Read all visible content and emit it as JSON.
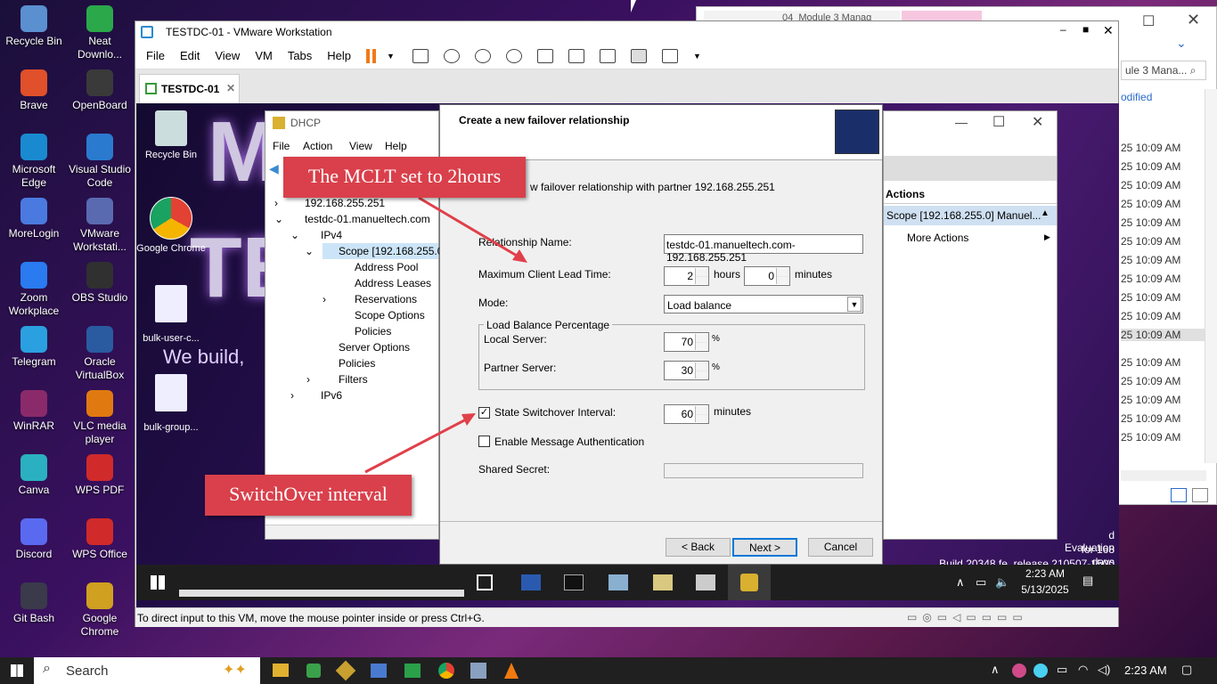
{
  "desktop": {
    "icons": [
      {
        "label": "Recycle Bin",
        "color": "#5a8fd0"
      },
      {
        "label": "Neat Downlo...",
        "color": "#2aa84a"
      },
      {
        "label": "Brave",
        "color": "#e0502a"
      },
      {
        "label": "OpenBoard",
        "color": "#3a3a3a"
      },
      {
        "label": "Microsoft Edge",
        "color": "#1a8ad0"
      },
      {
        "label": "Visual Studio Code",
        "color": "#2a7ad0"
      },
      {
        "label": "MoreLogin",
        "color": "#4a7ae0"
      },
      {
        "label": "VMware Workstati...",
        "color": "#5a6ab0"
      },
      {
        "label": "Zoom Workplace",
        "color": "#2a7af0"
      },
      {
        "label": "OBS Studio",
        "color": "#303030"
      },
      {
        "label": "Telegram",
        "color": "#2aa0e0"
      },
      {
        "label": "Oracle VirtualBox",
        "color": "#2a5aa0"
      },
      {
        "label": "WinRAR",
        "color": "#8a2a6a"
      },
      {
        "label": "VLC media player",
        "color": "#e07a10"
      },
      {
        "label": "Canva",
        "color": "#2ab0c0"
      },
      {
        "label": "WPS PDF",
        "color": "#d02a2a"
      },
      {
        "label": "Discord",
        "color": "#5a6af0"
      },
      {
        "label": "WPS Office",
        "color": "#d02a2a"
      },
      {
        "label": "Git Bash",
        "color": "#3a3a4a"
      },
      {
        "label": "Google Chrome",
        "color": "#d0a020"
      }
    ]
  },
  "vmware": {
    "title": "TESTDC-01 - VMware Workstation",
    "menu": [
      "File",
      "Edit",
      "View",
      "VM",
      "Tabs",
      "Help"
    ],
    "tab": "TESTDC-01",
    "status": "To direct input to this VM, move the mouse pointer inside or press Ctrl+G."
  },
  "guest": {
    "desktop_icons": [
      "Recycle Bin",
      "Google Chrome",
      "bulk-user-c...",
      "bulk-group..."
    ],
    "banner_text": "We build,",
    "eval": [
      "d Evaluation",
      "for 168 days",
      "Build 20348.fe_release.210507-1500"
    ],
    "clock_time": "2:23 AM",
    "clock_date": "5/13/2025"
  },
  "dhcp": {
    "title": "DHCP",
    "menu": [
      "File",
      "Action",
      "View",
      "Help"
    ],
    "tree": [
      "192.168.255.251",
      "testdc-01.manueltech.com",
      "IPv4",
      "Scope [192.168.255.0]",
      "Address Pool",
      "Address Leases",
      "Reservations",
      "Scope Options",
      "Policies",
      "Server Options",
      "Policies",
      "Filters",
      "IPv6"
    ],
    "actions_header": "Actions",
    "actions_scope": "Scope [192.168.255.0] Manuel...",
    "more_actions": "More Actions"
  },
  "dialog": {
    "heading": "Create a new failover relationship",
    "intro": "w failover relationship with partner 192.168.255.251",
    "rel_name_label": "Relationship Name:",
    "rel_name_value": "testdc-01.manueltech.com-192.168.255.251",
    "mclt_label": "Maximum Client Lead Time:",
    "mclt_hours": "2",
    "hours_unit": "hours",
    "mclt_minutes": "0",
    "minutes_unit": "minutes",
    "mode_label": "Mode:",
    "mode_value": "Load balance",
    "lb_group": "Load Balance Percentage",
    "local_label": "Local Server:",
    "local_value": "70",
    "partner_label": "Partner Server:",
    "partner_value": "30",
    "pct": "%",
    "ssi_label": "State Switchover Interval:",
    "ssi_value": "60",
    "ssi_unit": "minutes",
    "auth_label": "Enable Message Authentication",
    "secret_label": "Shared Secret:",
    "back": "< Back",
    "next": "Next >",
    "cancel": "Cancel"
  },
  "annotations": {
    "mclt": "The MCLT set to 2hours",
    "switchover": "SwitchOver interval"
  },
  "outlook": {
    "tab": "04_Module 3 Manag",
    "search": "ule 3 Mana...",
    "modified": "odified",
    "times": [
      "25 10:09 AM",
      "25 10:09 AM",
      "25 10:09 AM",
      "25 10:09 AM",
      "25 10:09 AM",
      "25 10:09 AM",
      "25 10:09 AM",
      "25 10:09 AM",
      "25 10:09 AM",
      "25 10:09 AM",
      "25 10:09 AM",
      "25 10:09 AM",
      "25 10:09 AM",
      "25 10:09 AM",
      "25 10:09 AM",
      "25 10:09 AM"
    ]
  },
  "host_taskbar": {
    "search": "Search",
    "time": "2:23 AM"
  }
}
